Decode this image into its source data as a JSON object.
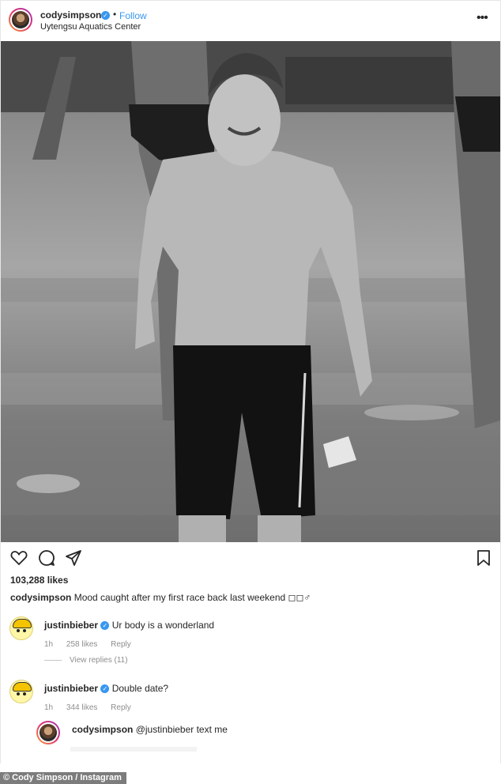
{
  "post": {
    "author": "codysimpson",
    "follow_label": "Follow",
    "dot": "•",
    "location": "Uytengsu Aquatics Center",
    "more_glyph": "•••",
    "likes": "103,288 likes",
    "caption": {
      "author": "codysimpson",
      "text": "Mood caught after my first race back last weekend ◻◻♂"
    }
  },
  "comments": [
    {
      "author": "justinbieber",
      "text": "Ur body is a wonderland",
      "time": "1h",
      "likes": "258 likes",
      "reply_label": "Reply",
      "view_replies": "View replies (11)"
    },
    {
      "author": "justinbieber",
      "text": "Double date?",
      "time": "1h",
      "likes": "344 likes",
      "reply_label": "Reply"
    }
  ],
  "reply": {
    "author": "codysimpson",
    "text": "@justinbieber text me"
  },
  "credit": "© Cody Simpson / Instagram",
  "colors": {
    "link_blue": "#3897f0",
    "text": "#262626",
    "muted": "#8e8e8e"
  },
  "icons": {
    "header_more": "more-dots-icon",
    "like": "heart-outline-icon",
    "comment": "comment-bubble-icon",
    "share": "paper-plane-icon",
    "save": "bookmark-icon",
    "verified": "verified-badge-icon"
  }
}
